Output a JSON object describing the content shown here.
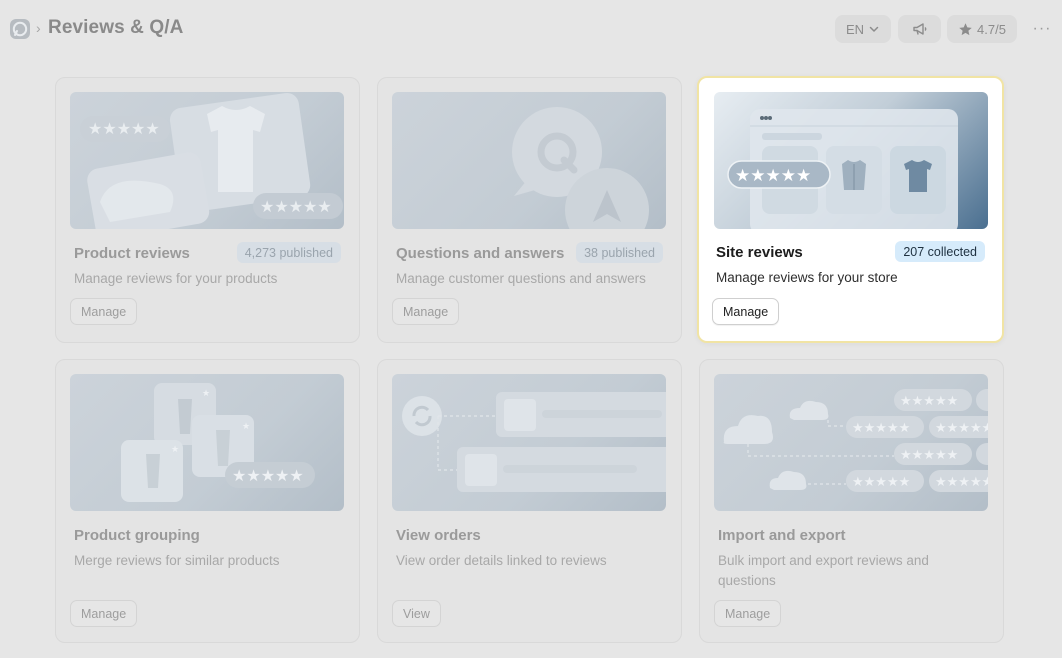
{
  "header": {
    "title": "Reviews & Q/A",
    "separator": "›",
    "language": "EN",
    "rating": "4.7/5",
    "more": "···"
  },
  "cards": [
    {
      "title": "Product reviews",
      "badge": "4,273 published",
      "description": "Manage reviews for your products",
      "button": "Manage",
      "active": false
    },
    {
      "title": "Questions and answers",
      "badge": "38 published",
      "description": "Manage customer questions and answers",
      "button": "Manage",
      "active": false
    },
    {
      "title": "Site reviews",
      "badge": "207 collected",
      "description": "Manage reviews for your store",
      "button": "Manage",
      "active": true
    },
    {
      "title": "Product grouping",
      "badge": "",
      "description": "Merge reviews for similar products",
      "button": "Manage",
      "active": false
    },
    {
      "title": "View orders",
      "badge": "",
      "description": "View order details linked to reviews",
      "button": "View",
      "active": false
    },
    {
      "title": "Import and export",
      "badge": "",
      "description": "Bulk import and export reviews and questions",
      "button": "Manage",
      "active": false
    }
  ],
  "icons": {
    "logo": "chat-bubble-logo-icon",
    "language_chevron": "chevron-down-icon",
    "announce": "megaphone-icon",
    "rating": "star-icon",
    "more": "more-horizontal-icon"
  },
  "colors": {
    "background": "#e6e6e6",
    "active_border": "#f1e4a4",
    "active_badge_bg": "#d6ebfb",
    "accent_blue": "#4a6f90"
  }
}
